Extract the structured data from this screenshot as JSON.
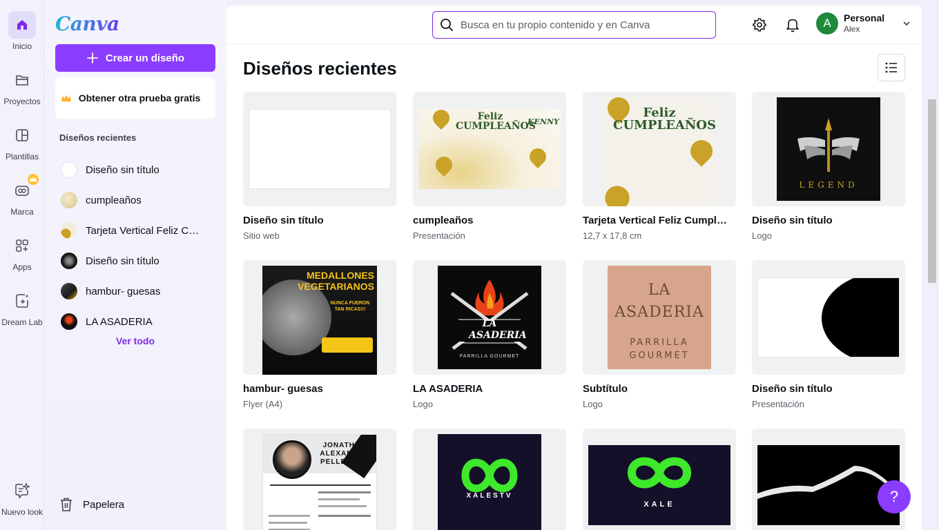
{
  "rail": {
    "items": [
      {
        "label": "Inicio",
        "icon": "home-icon"
      },
      {
        "label": "Proyectos",
        "icon": "folder-icon"
      },
      {
        "label": "Plantillas",
        "icon": "templates-icon"
      },
      {
        "label": "Marca",
        "icon": "brand-icon"
      },
      {
        "label": "Apps",
        "icon": "apps-icon"
      },
      {
        "label": "Dream Lab",
        "icon": "dream-lab-icon"
      },
      {
        "label": "Nuevo look",
        "icon": "sparkle-chat-icon"
      }
    ]
  },
  "panel": {
    "logo": "Canva",
    "create_label": "Crear un diseño",
    "trial_label": "Obtener otra prueba gratis",
    "recent_heading": "Diseños recientes",
    "recent": [
      {
        "name": "Diseño sin título"
      },
      {
        "name": "cumpleaños"
      },
      {
        "name": "Tarjeta Vertical Feliz Cumpleaños"
      },
      {
        "name": "Diseño sin título"
      },
      {
        "name": "hambur- guesas"
      },
      {
        "name": "LA ASADERIA"
      }
    ],
    "see_all": "Ver todo",
    "trash": "Papelera"
  },
  "header": {
    "search_placeholder": "Busca en tu propio contenido y en Canva",
    "account_name": "Personal",
    "account_user": "Alex",
    "avatar_letter": "A"
  },
  "main": {
    "title": "Diseños recientes",
    "cards": [
      {
        "title": "Diseño sin título",
        "sub": "Sitio web"
      },
      {
        "title": "cumpleaños",
        "sub": "Presentación",
        "thumb_text": "Feliz CUMPLEAÑOS",
        "thumb_text2": "KENNY"
      },
      {
        "title": "Tarjeta Vertical Feliz Cumpleaños",
        "sub": "12,7 x 17,8 cm",
        "thumb_text": "Feliz CUMPLEAÑOS"
      },
      {
        "title": "Diseño sin título",
        "sub": "Logo",
        "thumb_text": "LEGEND"
      },
      {
        "title": "hambur- guesas",
        "sub": "Flyer (A4)",
        "thumb_text": "MEDALLONES VEGETARIANOS",
        "thumb_text2": "NUNCA FUERON TAN RICAS!!!"
      },
      {
        "title": "LA ASADERIA",
        "sub": "Logo",
        "thumb_text": "LA ASADERIA",
        "thumb_text2": "PARRILLA GOURMET"
      },
      {
        "title": "Subtítulo",
        "sub": "Logo",
        "thumb_text": "LA ASADERIA",
        "thumb_text2": "PARRILLA GOURMET"
      },
      {
        "title": "Diseño sin título",
        "sub": "Presentación"
      },
      {
        "title": "",
        "sub": "",
        "thumb_text": "JONATHAN ALEXANDER PELLEGRINI"
      },
      {
        "title": "",
        "sub": "",
        "thumb_text": "XALESTV"
      },
      {
        "title": "",
        "sub": "",
        "thumb_text": "XALE"
      },
      {
        "title": "",
        "sub": ""
      }
    ]
  },
  "help_label": "?",
  "colors": {
    "accent": "#8b3dff",
    "link": "#7d2ae8"
  }
}
